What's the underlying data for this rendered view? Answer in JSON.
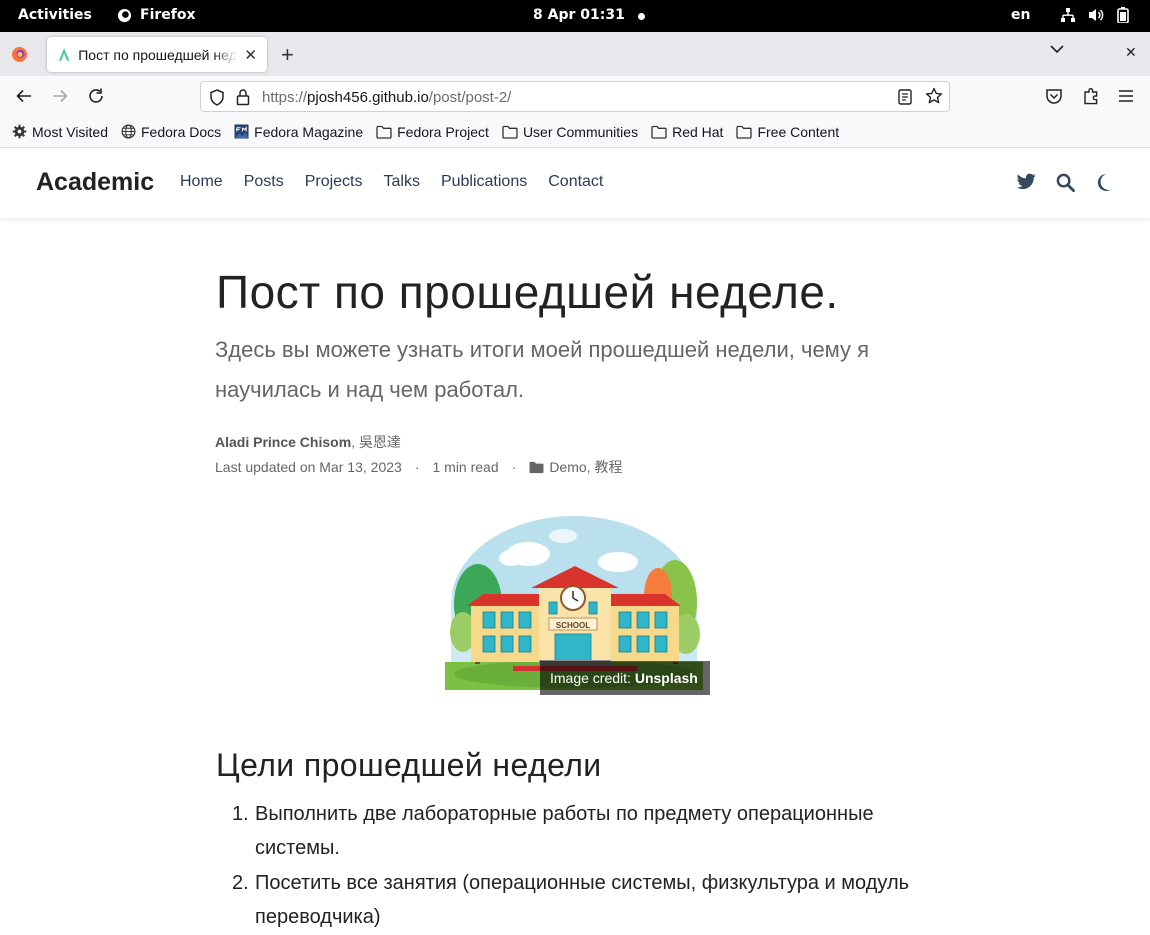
{
  "system": {
    "activities": "Activities",
    "app_name": "Firefox",
    "clock": "8 Apr  01:31",
    "language": "en"
  },
  "browser": {
    "tab_title": "Пост по прошедшей неделе.",
    "url_scheme": "https://",
    "url_host": "pjosh456.github.io",
    "url_path": "/post/post-2/",
    "bookmarks": [
      {
        "label": "Most Visited",
        "icon": "gear-icon"
      },
      {
        "label": "Fedora Docs",
        "icon": "globe-icon"
      },
      {
        "label": "Fedora Magazine",
        "icon": "fedora-magazine-icon"
      },
      {
        "label": "Fedora Project",
        "icon": "folder-icon"
      },
      {
        "label": "User Communities",
        "icon": "folder-icon"
      },
      {
        "label": "Red Hat",
        "icon": "folder-icon"
      },
      {
        "label": "Free Content",
        "icon": "folder-icon"
      }
    ]
  },
  "site": {
    "brand": "Academic",
    "menu": [
      "Home",
      "Posts",
      "Projects",
      "Talks",
      "Publications",
      "Contact"
    ]
  },
  "post": {
    "title": "Пост по прошедшей неделе.",
    "subtitle": "Здесь вы можете узнать итоги моей прошедшей недели, чему я научилась и над чем работал.",
    "author_primary": "Aladi Prince Chisom",
    "author_secondary": "吳恩達",
    "author_separator": ", ",
    "last_updated": "Last updated on Mar 13, 2023",
    "read_time": "1 min read",
    "category_1": "Demo",
    "category_2": "教程",
    "meta_sep": "·",
    "image_sign": "SCHOOL",
    "credit_prefix": "Image credit: ",
    "credit_link": "Unsplash",
    "section_heading": "Цели прошедшей недели",
    "goals": [
      {
        "num": "1.",
        "text": "Выполнить две лабораторные работы по предмету операционные системы."
      },
      {
        "num": "2.",
        "text": "Посетить все занятия (операционные системы, физкультура и модуль переводчика)"
      }
    ]
  },
  "colors": {
    "nav_link": "#2b3b57",
    "page_bg": "#ffffff",
    "browser_chrome": "#f9f9fb",
    "tab_strip": "#e9e9ed"
  }
}
